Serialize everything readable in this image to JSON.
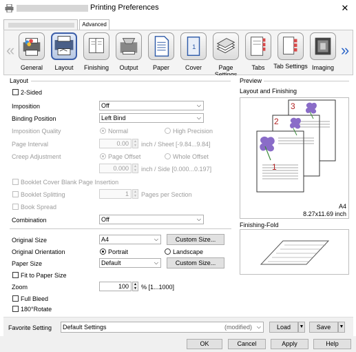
{
  "window": {
    "title": "Printing Preferences",
    "close_glyph": "✕"
  },
  "printer_tabs": [
    "",
    "Advanced"
  ],
  "ribbon": {
    "items": [
      "General",
      "Layout",
      "Finishing",
      "Output",
      "Paper",
      "Cover",
      "Page Settings",
      "Tabs",
      "Tab Settings",
      "Imaging"
    ],
    "selected": "Layout",
    "left_arrow": "«",
    "right_arrow": "»"
  },
  "layout_group": {
    "title": "Layout",
    "two_sided": "2-Sided",
    "imposition": {
      "label": "Imposition",
      "value": "Off"
    },
    "binding_position": {
      "label": "Binding Position",
      "value": "Left Bind"
    },
    "imposition_quality": {
      "label": "Imposition Quality",
      "opt1": "Normal",
      "opt2": "High Precision"
    },
    "page_interval": {
      "label": "Page Interval",
      "value": "0.00",
      "unit": "inch / Sheet [-9.84...9.84]"
    },
    "creep_adjustment": {
      "label": "Creep Adjustment",
      "opt1": "Page Offset",
      "opt2": "Whole Offset",
      "value": "0.000",
      "unit": "inch / Side [0.000...0.197]"
    },
    "booklet_cover_blank": "Booklet Cover Blank Page Insertion",
    "booklet_splitting": {
      "label": "Booklet Splitting",
      "value": "1",
      "unit": "Pages per Section"
    },
    "book_spread": "Book Spread",
    "combination": {
      "label": "Combination",
      "value": "Off"
    }
  },
  "original_group": {
    "original_size": {
      "label": "Original Size",
      "value": "A4",
      "button": "Custom Size..."
    },
    "original_orientation": {
      "label": "Original Orientation",
      "opt1": "Portrait",
      "opt2": "Landscape"
    },
    "paper_size": {
      "label": "Paper Size",
      "value": "Default",
      "button": "Custom Size..."
    },
    "fit_to_paper": "Fit to Paper Size",
    "zoom": {
      "label": "Zoom",
      "value": "100",
      "unit": "% [1...1000]"
    },
    "full_bleed": "Full Bleed",
    "rotate_180": "180°Rotate"
  },
  "preview": {
    "title": "Preview",
    "layout_finishing_title": "Layout and Finishing",
    "page_numbers": [
      "1",
      "2",
      "3"
    ],
    "paper_name": "A4",
    "paper_dims": "8.27x11.69 inch",
    "finishing_fold_title": "Finishing-Fold"
  },
  "favorite": {
    "label": "Favorite Setting",
    "value": "Default Settings",
    "status": "(modified)",
    "load": "Load",
    "save": "Save"
  },
  "buttons": {
    "ok": "OK",
    "cancel": "Cancel",
    "apply": "Apply",
    "help": "Help"
  },
  "colors": {
    "accent": "#3c5ea8",
    "page_number": "#b02020"
  }
}
